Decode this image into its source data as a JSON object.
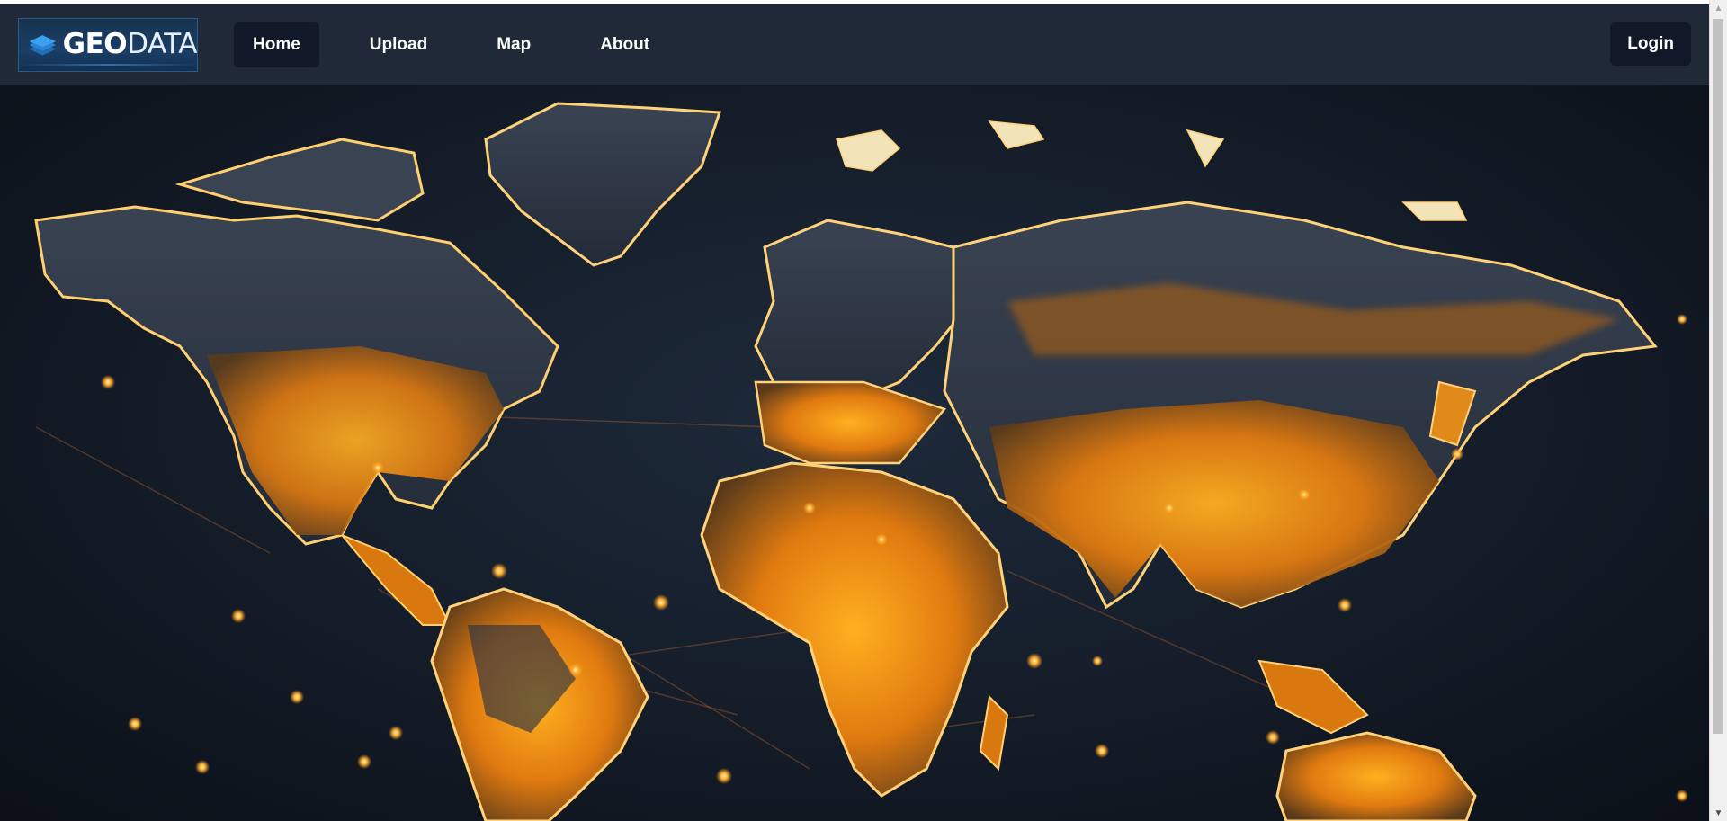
{
  "brand": {
    "logo_bold": "GEO",
    "logo_light": "DATA",
    "colors": {
      "logo_bg": "#1c3e66",
      "logo_icon": "#2f8fe0"
    }
  },
  "nav": {
    "items": [
      {
        "label": "Home",
        "active": true
      },
      {
        "label": "Upload",
        "active": false
      },
      {
        "label": "Map",
        "active": false
      },
      {
        "label": "About",
        "active": false
      }
    ],
    "login_label": "Login",
    "colors": {
      "bar": "#1f2937",
      "active_bg": "#111827",
      "text": "#ffffff"
    }
  },
  "hero": {
    "image": "glowing-world-map",
    "colors": {
      "background": "#141c28",
      "land_glow": "#f59e0b",
      "land_edge": "#ffd27a"
    }
  },
  "scrollbar": {
    "up_icon": "scroll-up-arrow-icon",
    "down_icon": "scroll-down-arrow-icon"
  }
}
